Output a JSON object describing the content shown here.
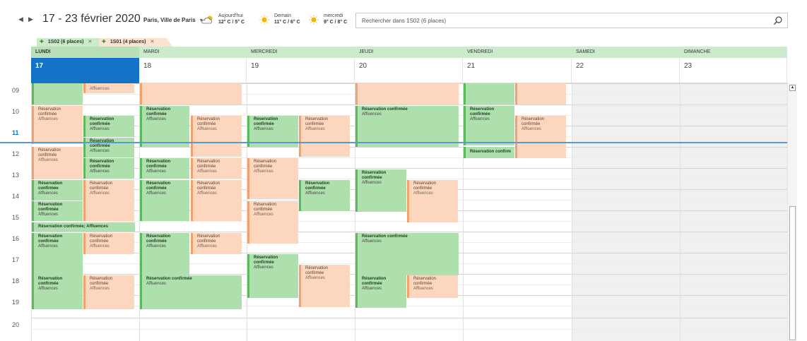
{
  "nav": {
    "prev_icon": "◀",
    "next_icon": "▶"
  },
  "header": {
    "date_range": "17 - 23 février 2020",
    "location": "Paris, Ville de Paris",
    "location_caret": "▾"
  },
  "weather": [
    {
      "label": "Aujourd'hui",
      "temp": "12° C / 5° C",
      "icon": "partly-cloudy-icon"
    },
    {
      "label": "Demain",
      "temp": "11° C / 6° C",
      "icon": "sun-icon"
    },
    {
      "label": "mercredi",
      "temp": "9° C / 8° C",
      "icon": "sun-icon"
    }
  ],
  "search": {
    "placeholder": "Rechercher dans 1S02 (6 places)",
    "icon": "search-icon"
  },
  "calendar_tabs": [
    {
      "label": "1S02 (6 places)",
      "close": "✕"
    },
    {
      "label": "1S01 (4 places)",
      "close": "✕"
    }
  ],
  "days": [
    {
      "name": "LUNDI",
      "number": "17",
      "today": true
    },
    {
      "name": "MARDI",
      "number": "18"
    },
    {
      "name": "MERCREDI",
      "number": "19"
    },
    {
      "name": "JEUDI",
      "number": "20"
    },
    {
      "name": "VENDREDI",
      "number": "21"
    },
    {
      "name": "SAMEDI",
      "number": "22"
    },
    {
      "name": "DIMANCHE",
      "number": "23"
    }
  ],
  "hours": [
    "09",
    "10",
    "11",
    "12",
    "13",
    "14",
    "15",
    "16",
    "17",
    "18",
    "19",
    "20"
  ],
  "current_hour": "11",
  "event_text": {
    "title": "Réservation confirmée",
    "subtitle": "Affluences",
    "title_inline": "Réservation confirmée; Affluences",
    "title_truncated": "Réservation confirm",
    "title_wrap_1": "Réservation",
    "title_wrap_2": "confirmée"
  },
  "colors": {
    "accent": "#1473c6",
    "room_1S02": "#aee0ae",
    "room_1S01": "#fcd7bd",
    "current_time_line": "#5a9ad4"
  }
}
